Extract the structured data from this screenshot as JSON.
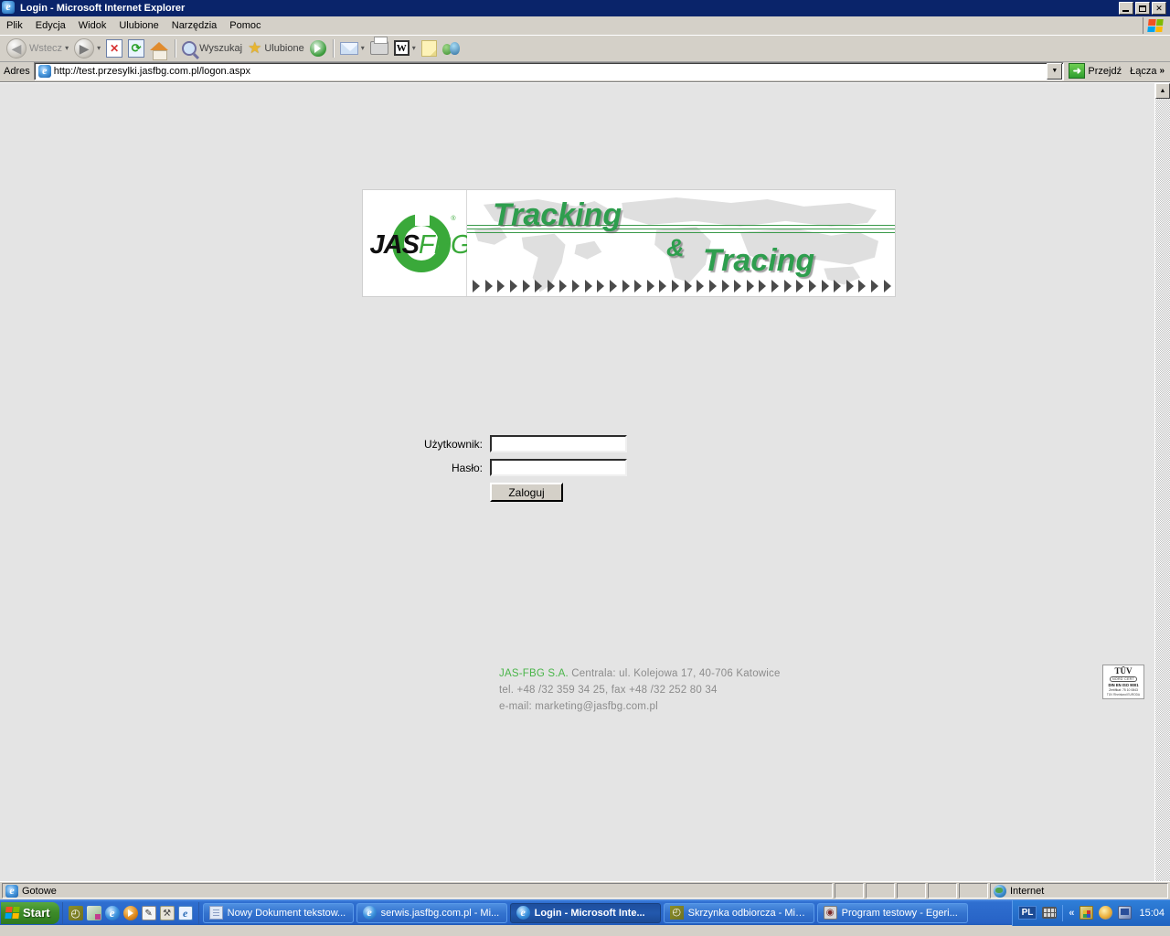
{
  "window": {
    "title": "Login - Microsoft Internet Explorer",
    "icon": "ie-icon",
    "minimize_label": "_",
    "restore_label": "❐",
    "close_label": "✕"
  },
  "menu": {
    "items": [
      {
        "label": "Plik"
      },
      {
        "label": "Edycja"
      },
      {
        "label": "Widok"
      },
      {
        "label": "Ulubione"
      },
      {
        "label": "Narzędzia"
      },
      {
        "label": "Pomoc"
      }
    ],
    "brand_icon": "windows-flag-icon"
  },
  "toolbar": {
    "back_label": "Wstecz",
    "forward_label": "",
    "stop_icon": "stop-icon",
    "refresh_icon": "refresh-icon",
    "home_icon": "home-icon",
    "search_label": "Wyszukaj",
    "favorites_label": "Ulubione",
    "media_icon": "media-icon",
    "mail_icon": "mail-icon",
    "print_icon": "print-icon",
    "word_icon": "word-icon",
    "word_glyph": "W",
    "notes_icon": "notes-icon",
    "messenger_icon": "messenger-icon",
    "caret_glyph": "▾"
  },
  "address": {
    "label": "Adres",
    "value": "http://test.przesylki.jasfbg.com.pl/logon.aspx",
    "placeholder": "",
    "dropdown_glyph": "▼",
    "go_label": "Przejdź",
    "go_glyph": "➜",
    "links_label": "Łącza",
    "links_chevron": "»"
  },
  "banner": {
    "logo": {
      "primary": "JAS",
      "secondary": "FBG",
      "registered": "®"
    },
    "title_word1": "Tracking",
    "title_amp": "&",
    "title_word2": "Tracing",
    "accent_color": "#2e9e4e",
    "arrow_count": 34
  },
  "login": {
    "username_label": "Użytkownik:",
    "username_value": "",
    "username_placeholder": "",
    "password_label": "Hasło:",
    "password_value": "",
    "password_placeholder": "",
    "submit_label": "Zaloguj"
  },
  "footer": {
    "company": "JAS-FBG S.A.",
    "address": " Centrala: ul. Kolejowa 17, 40-706  Katowice",
    "phone": "tel. +48 /32 359 34 25, fax +48 /32 252 80 34",
    "email": "e-mail: marketing@jasfbg.com.pl",
    "company_color": "#4ab54a",
    "text_color": "#8c8c8c"
  },
  "certificate": {
    "brand": "TÜV",
    "sub": "NORD CERT",
    "standard": "DIN EN ISO 9001",
    "number": "Zertifikat: 75 10 0843",
    "body": "TÜV Rheinland EURODA"
  },
  "statusbar": {
    "message": "Gotowe",
    "zone": "Internet",
    "zone_icon": "globe-icon"
  },
  "taskbar": {
    "start_label": "Start",
    "quick_launch": [
      {
        "name": "outlook-icon"
      },
      {
        "name": "excel-icon"
      },
      {
        "name": "internet-explorer-icon"
      },
      {
        "name": "media-player-icon"
      },
      {
        "name": "notepad-icon"
      },
      {
        "name": "tools-icon"
      },
      {
        "name": "browser-icon"
      }
    ],
    "tasks": [
      {
        "label": "Nowy Dokument tekstow...",
        "icon": "notepad-icon",
        "active": false
      },
      {
        "label": "serwis.jasfbg.com.pl - Mi...",
        "icon": "ie-icon",
        "active": false
      },
      {
        "label": "Login - Microsoft Inte...",
        "icon": "ie-icon",
        "active": true
      },
      {
        "label": "Skrzynka odbiorcza - Mic...",
        "icon": "outlook-icon",
        "active": false
      },
      {
        "label": "Program testowy -  Egeri...",
        "icon": "program-icon",
        "active": false
      }
    ],
    "language": "PL",
    "keyboard_icon": "keyboard-icon",
    "tray_chevron": "«",
    "tray_icons": [
      {
        "name": "clipboard-icon"
      },
      {
        "name": "network-icon"
      },
      {
        "name": "display-icon"
      }
    ],
    "clock": "15:04"
  },
  "scrollbar": {
    "up_glyph": "▲",
    "down_glyph": "▼"
  }
}
